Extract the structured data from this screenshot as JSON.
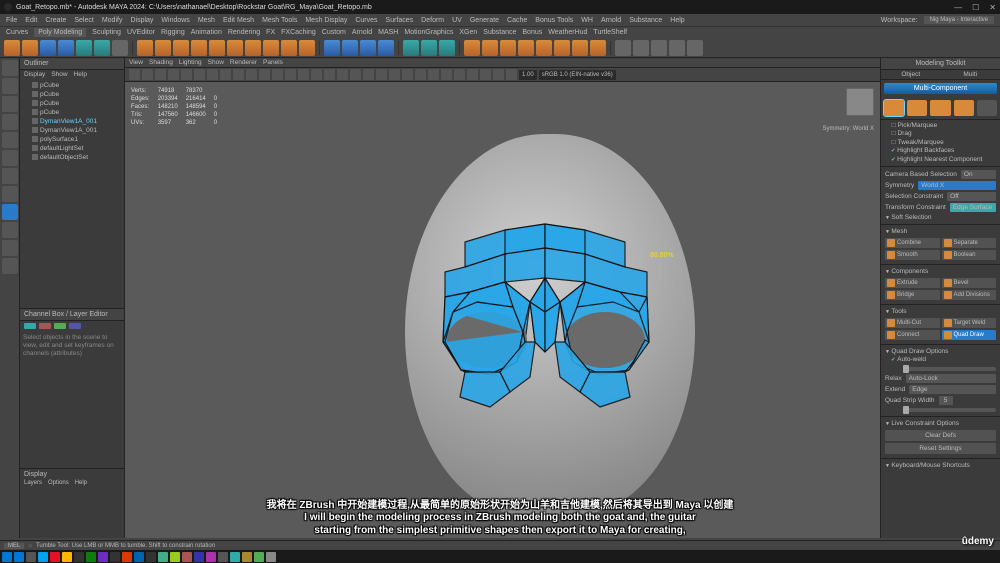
{
  "title": "Goat_Retopo.mb* - Autodesk MAYA 2024: C:\\Users\\nathanael\\Desktop\\Rockstar Goat\\RG_Maya\\Goat_Retopo.mb",
  "menubar": [
    "File",
    "Edit",
    "Create",
    "Select",
    "Modify",
    "Display",
    "Windows",
    "Mesh",
    "Edit Mesh",
    "Mesh Tools",
    "Mesh Display",
    "Curves",
    "Surfaces",
    "Deform",
    "UV",
    "Generate",
    "Cache",
    "Bonus Tools",
    "WH",
    "Arnold",
    "Substance",
    "Help"
  ],
  "workspace_label": "Workspace:",
  "workspace_value": "Nig Maya - Interactive",
  "shelftabs": [
    "Curves",
    "Poly Modeling",
    "Sculpting",
    "UVEditor",
    "Rigging",
    "Animation",
    "Rendering",
    "FX",
    "FXCaching",
    "Custom",
    "Arnold",
    "MASH",
    "MotionGraphics",
    "XGen",
    "Substance",
    "Bonus",
    "WeatherHud",
    "TurtleShelf"
  ],
  "shelftab_active": "Poly Modeling",
  "outliner": {
    "title": "Outliner",
    "menu": [
      "Display",
      "Show",
      "Help"
    ],
    "items": [
      "pCube",
      "pCube",
      "pCube",
      "pCube",
      "DymanView1A_001",
      "DymanView1A_001",
      "polySurface1",
      "defaultLightSet",
      "defaultObjectSet"
    ],
    "selected_index": 4
  },
  "chanbox": {
    "title": "Channel Box / Layer Editor",
    "hint": "Select objects in the scene to view, edit and set keyframes on channels (attributes)"
  },
  "display": {
    "title": "Display",
    "rows": [
      "Layers",
      "Options",
      "Help"
    ]
  },
  "vp_menu": [
    "View",
    "Shading",
    "Lighting",
    "Show",
    "Renderer",
    "Panels"
  ],
  "vp_gate": "sRGB 1.0 (EIN-native v36)",
  "stats": {
    "rows": [
      [
        "Verts:",
        "74918",
        "78370"
      ],
      [
        "Edges:",
        "203394",
        "216414"
      ],
      [
        "Faces:",
        "148210",
        "148594"
      ],
      [
        "Tris:",
        "147560",
        "146600"
      ],
      [
        "UVs:",
        "3597",
        "362"
      ]
    ],
    "extra_col": [
      "",
      "0",
      "0",
      "0",
      "0"
    ]
  },
  "symmetry_label": "Symmetry: World X",
  "dim_label": "80.80%",
  "toolkit": {
    "title": "Modeling Toolkit",
    "tabs": [
      "Object",
      "Multi"
    ],
    "multi_btn": "Multi-Component",
    "pick": "Pick/Marquee",
    "drag": "Drag",
    "tweak": "Tweak/Marquee",
    "hl_back": "Highlight Backfaces",
    "hl_near": "Highlight Nearest Component",
    "cam_sel_lbl": "Camera Based Selection",
    "cam_sel_val": "On",
    "sym_lbl": "Symmetry",
    "sym_val": "World X",
    "sel_con_lbl": "Selection Constraint",
    "sel_con_val": "Off",
    "trans_con_lbl": "Transform Constraint",
    "trans_con_val": "Edge Surface",
    "soft_sel": "Soft Selection",
    "mesh_sec": "Mesh",
    "mesh_btns": [
      "Combine",
      "Separate",
      "Smooth",
      "Boolean"
    ],
    "comp_sec": "Components",
    "comp_btns": [
      "Extrude",
      "Bevel",
      "Bridge",
      "Add Divisions"
    ],
    "tools_sec": "Tools",
    "tool_btns": [
      "Multi-Cut",
      "Target Weld",
      "Connect",
      "Quad Draw"
    ],
    "quad_opts_hdr": "Quad Draw Options",
    "auto_weld": "Auto-weld",
    "relax_lbl": "Relax",
    "relax_val": "Auto-Lock",
    "extend_lbl": "Extend",
    "extend_val": "Edge",
    "qsw_lbl": "Quad Strip Width",
    "qsw_val": "5",
    "lco_hdr": "Live Constraint Options",
    "clear": "Clear Defs",
    "reset": "Reset Settings",
    "kb_hdr": "Keyboard/Mouse Shortcuts"
  },
  "helpline": {
    "mel": "MEL",
    "text": "Tumble Tool: Use LMB or MMB to tumble. Shift to constrain rotation"
  },
  "subtitles": {
    "cn": "我将在 ZBrush 中开始建模过程,从最简单的原始形状开始为山羊和吉他建模,然后将其导出到 Maya 以创建",
    "en1": "I will begin the modeling process in ZBrush modeling both the goat and, the guitar",
    "en2": "starting from the simplest primitive shapes then export it to Maya for creating,"
  },
  "udemy": "ûdemy",
  "taskbar_colors": [
    "#0078d4",
    "#555",
    "#00a2ed",
    "#e81123",
    "#ffb900",
    "#333",
    "#107c10",
    "#6b2fbf",
    "#333",
    "#d83b01",
    "#0063b1",
    "#333",
    "#4a8",
    "#9c2",
    "#a55",
    "#33a",
    "#a3a",
    "#555",
    "#3aa",
    "#a83",
    "#5a5",
    "#888"
  ]
}
